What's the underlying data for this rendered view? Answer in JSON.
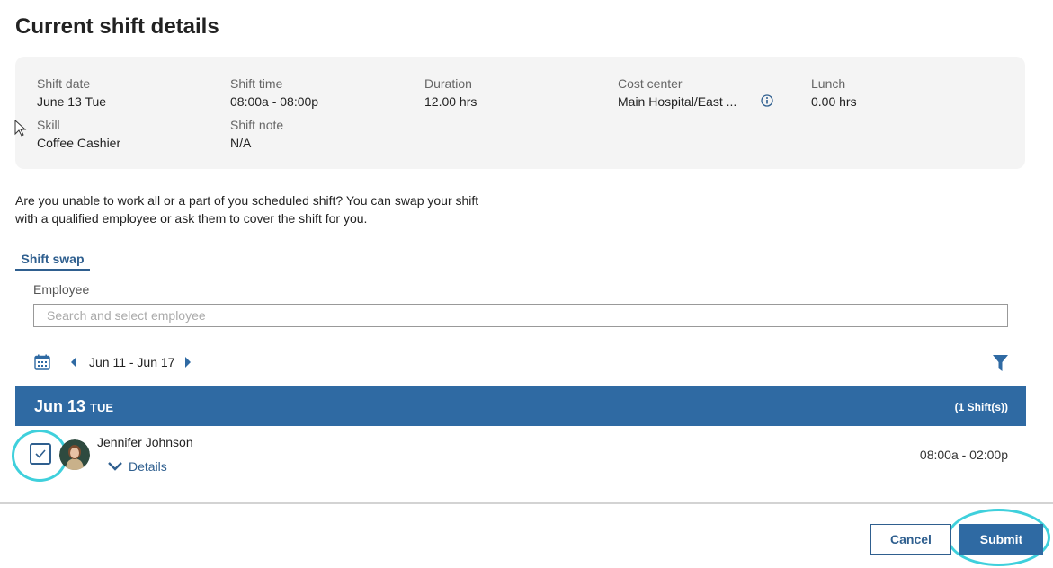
{
  "page": {
    "title": "Current shift details"
  },
  "shift": {
    "date_label": "Shift date",
    "date_value": "June 13 Tue",
    "time_label": "Shift time",
    "time_value": "08:00a - 08:00p",
    "duration_label": "Duration",
    "duration_value": "12.00 hrs",
    "cost_label": "Cost center",
    "cost_value": "Main Hospital/East ...",
    "lunch_label": "Lunch",
    "lunch_value": "0.00 hrs",
    "skill_label": "Skill",
    "skill_value": "Coffee Cashier",
    "note_label": "Shift note",
    "note_value": "N/A"
  },
  "intro": {
    "line1": "Are you unable to work all or a part of you scheduled shift? You can swap your shift",
    "line2": "with a qualified employee or ask them to cover the shift for you."
  },
  "tabs": [
    {
      "label": "Shift swap",
      "active": true
    }
  ],
  "employee": {
    "label": "Employee",
    "placeholder": "Search and select employee",
    "value": ""
  },
  "week": {
    "range": "Jun 11 - Jun 17"
  },
  "day": {
    "date": "Jun 13",
    "dow": "TUE",
    "count": "(1 Shift(s))"
  },
  "row": {
    "name": "Jennifer Johnson",
    "details_label": "Details",
    "time": "08:00a - 02:00p",
    "checked": true
  },
  "actions": {
    "cancel": "Cancel",
    "submit": "Submit"
  },
  "colors": {
    "accent": "#2f6aa3",
    "highlight_ring": "#3fd0dc",
    "card_bg": "#f4f4f4"
  },
  "icons": [
    "info-icon",
    "calendar-icon",
    "chevron-left-icon",
    "chevron-right-icon",
    "filter-icon",
    "checkbox-icon",
    "chevron-down-icon",
    "cursor-icon"
  ]
}
